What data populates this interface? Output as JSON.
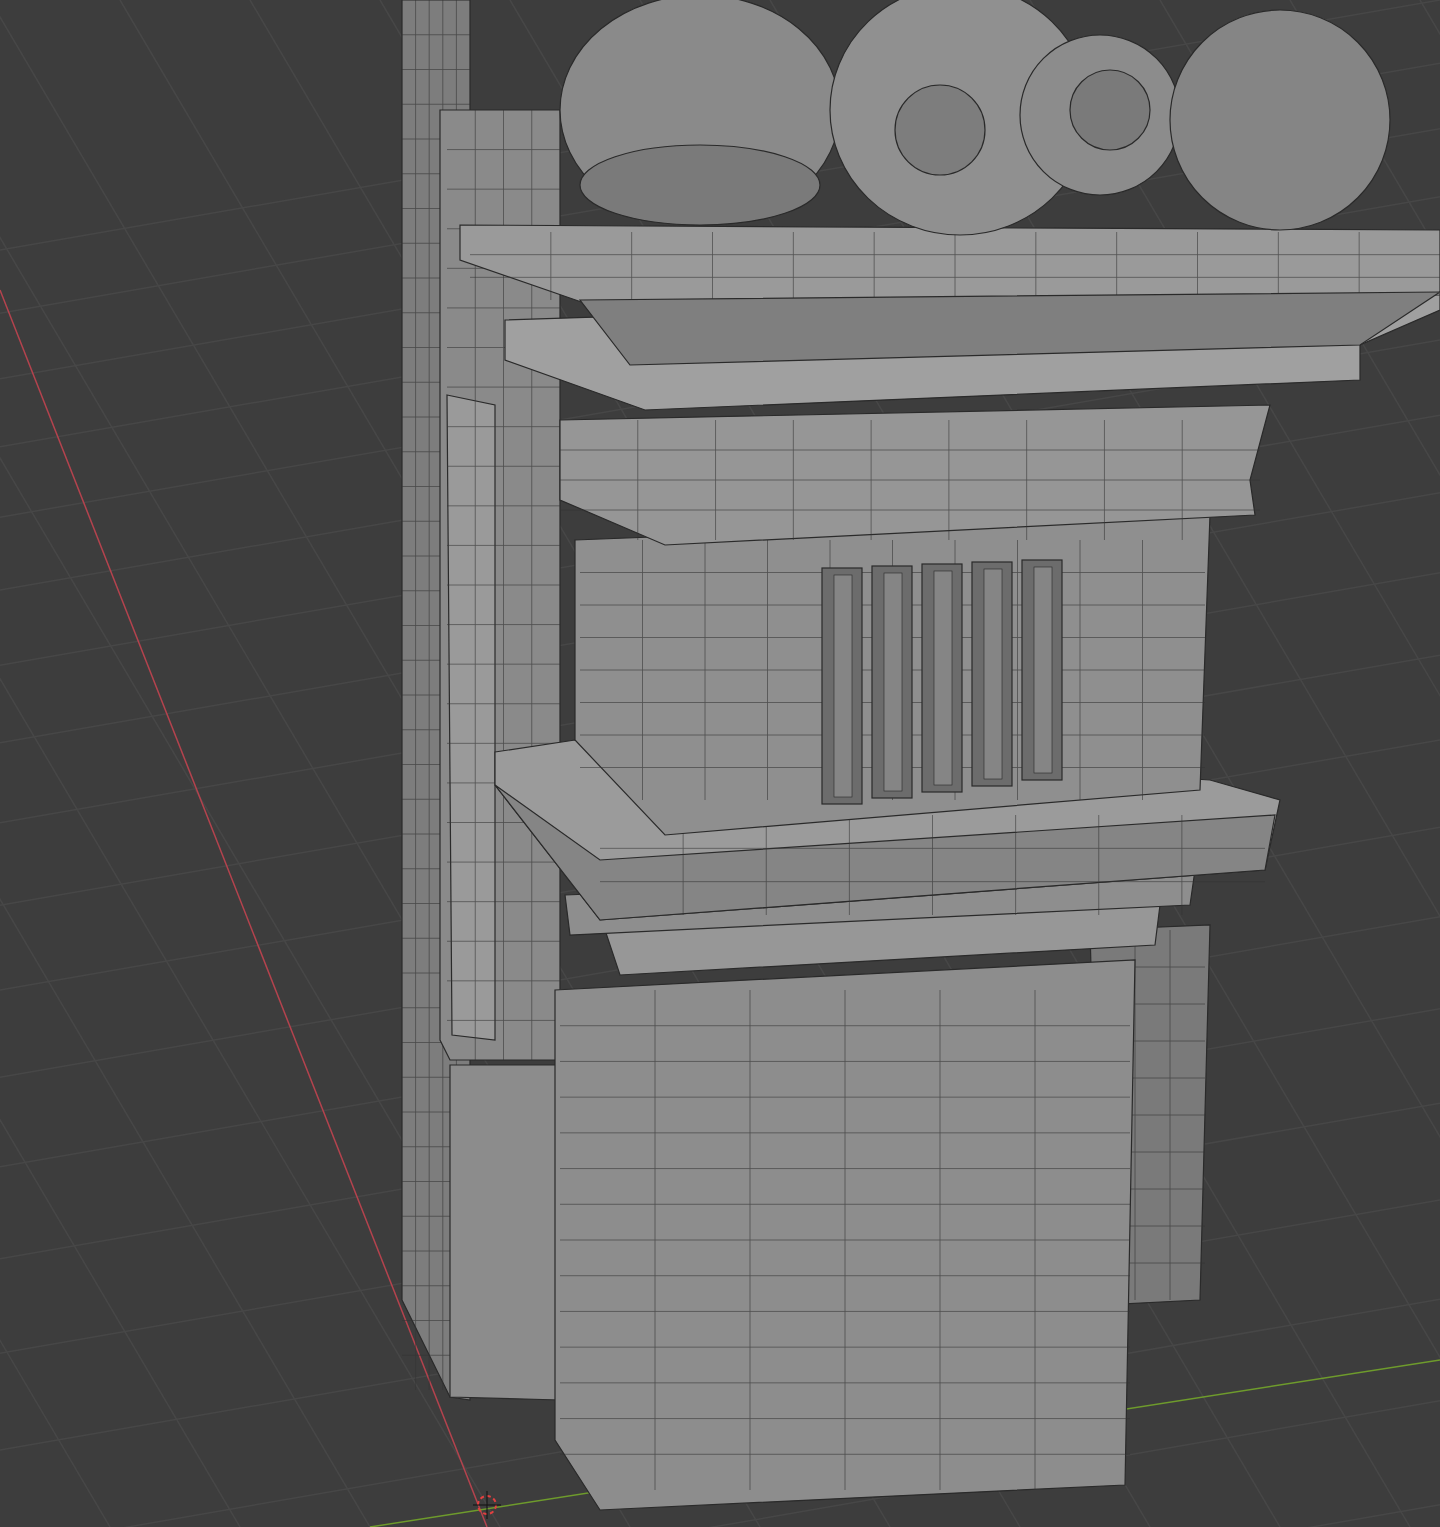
{
  "viewport": {
    "axes": [
      {
        "kind": "x",
        "color": "#b4434e"
      },
      {
        "kind": "y",
        "color": "#6e9b2c"
      }
    ]
  }
}
